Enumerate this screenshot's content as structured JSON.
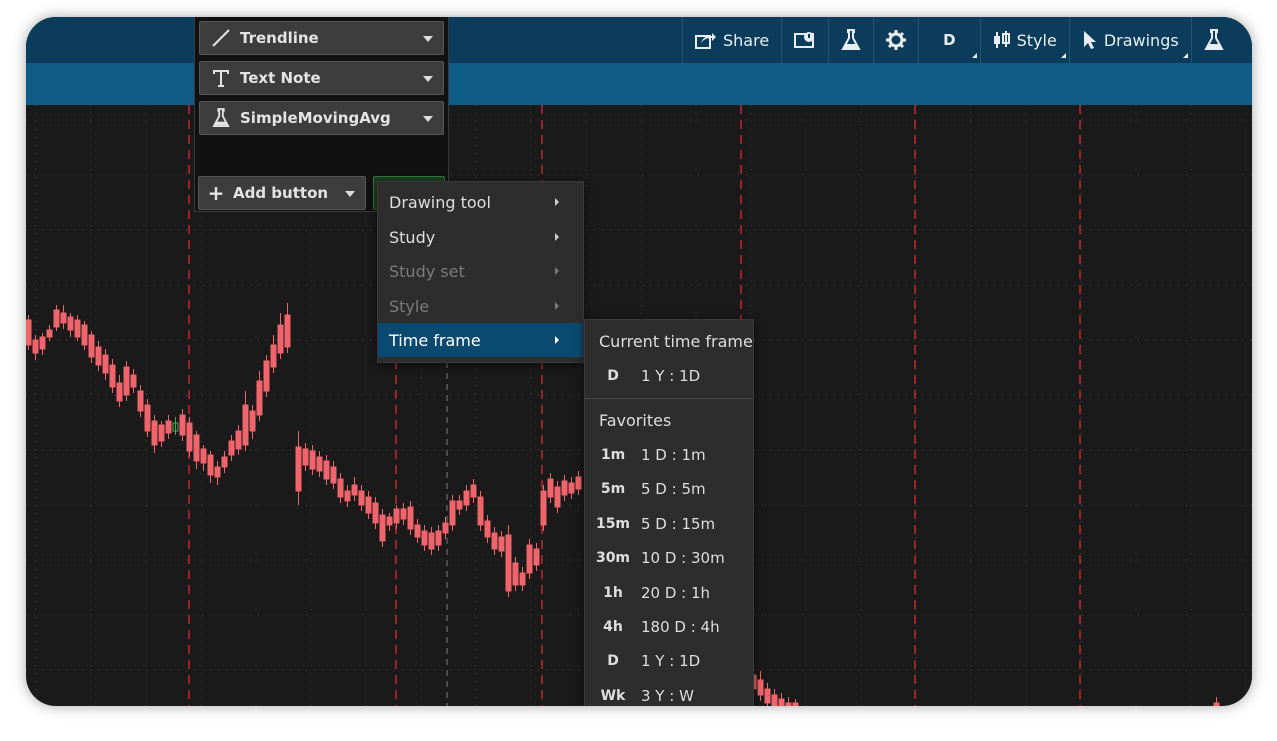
{
  "toolbar": {
    "share_label": "Share",
    "period_label": "D",
    "style_label": "Style",
    "drawings_label": "Drawings",
    "icons": [
      "share-icon",
      "flag-screen-icon",
      "flask-icon",
      "gear-icon",
      "candlestick-icon",
      "cursor-icon",
      "flask-icon"
    ]
  },
  "panel": {
    "buttons": [
      {
        "label": "Trendline",
        "icon": "trendline-icon"
      },
      {
        "label": "Text Note",
        "icon": "text-icon"
      },
      {
        "label": "SimpleMovingAvg",
        "icon": "flask-icon"
      }
    ],
    "add_label": "Add button"
  },
  "menu": {
    "items": [
      {
        "label": "Drawing tool",
        "state": "enabled"
      },
      {
        "label": "Study",
        "state": "enabled"
      },
      {
        "label": "Study set",
        "state": "disabled"
      },
      {
        "label": "Style",
        "state": "disabled"
      },
      {
        "label": "Time frame",
        "state": "selected"
      }
    ]
  },
  "timeframe": {
    "current_header": "Current time frame",
    "current": {
      "code": "D",
      "value": "1 Y : 1D"
    },
    "favorites_header": "Favorites",
    "favorites": [
      {
        "code": "1m",
        "value": "1 D : 1m"
      },
      {
        "code": "5m",
        "value": "5 D : 5m"
      },
      {
        "code": "15m",
        "value": "5 D : 15m"
      },
      {
        "code": "30m",
        "value": "10 D : 30m"
      },
      {
        "code": "1h",
        "value": "20 D : 1h"
      },
      {
        "code": "4h",
        "value": "180 D : 4h"
      },
      {
        "code": "D",
        "value": "1 Y : 1D"
      },
      {
        "code": "Wk",
        "value": "3 Y : W"
      }
    ]
  },
  "colors": {
    "up": "#3fae49",
    "down": "#f0646b",
    "accent": "#0b4a70",
    "grid": "#4a4a4a",
    "divider": "#c1272d"
  }
}
